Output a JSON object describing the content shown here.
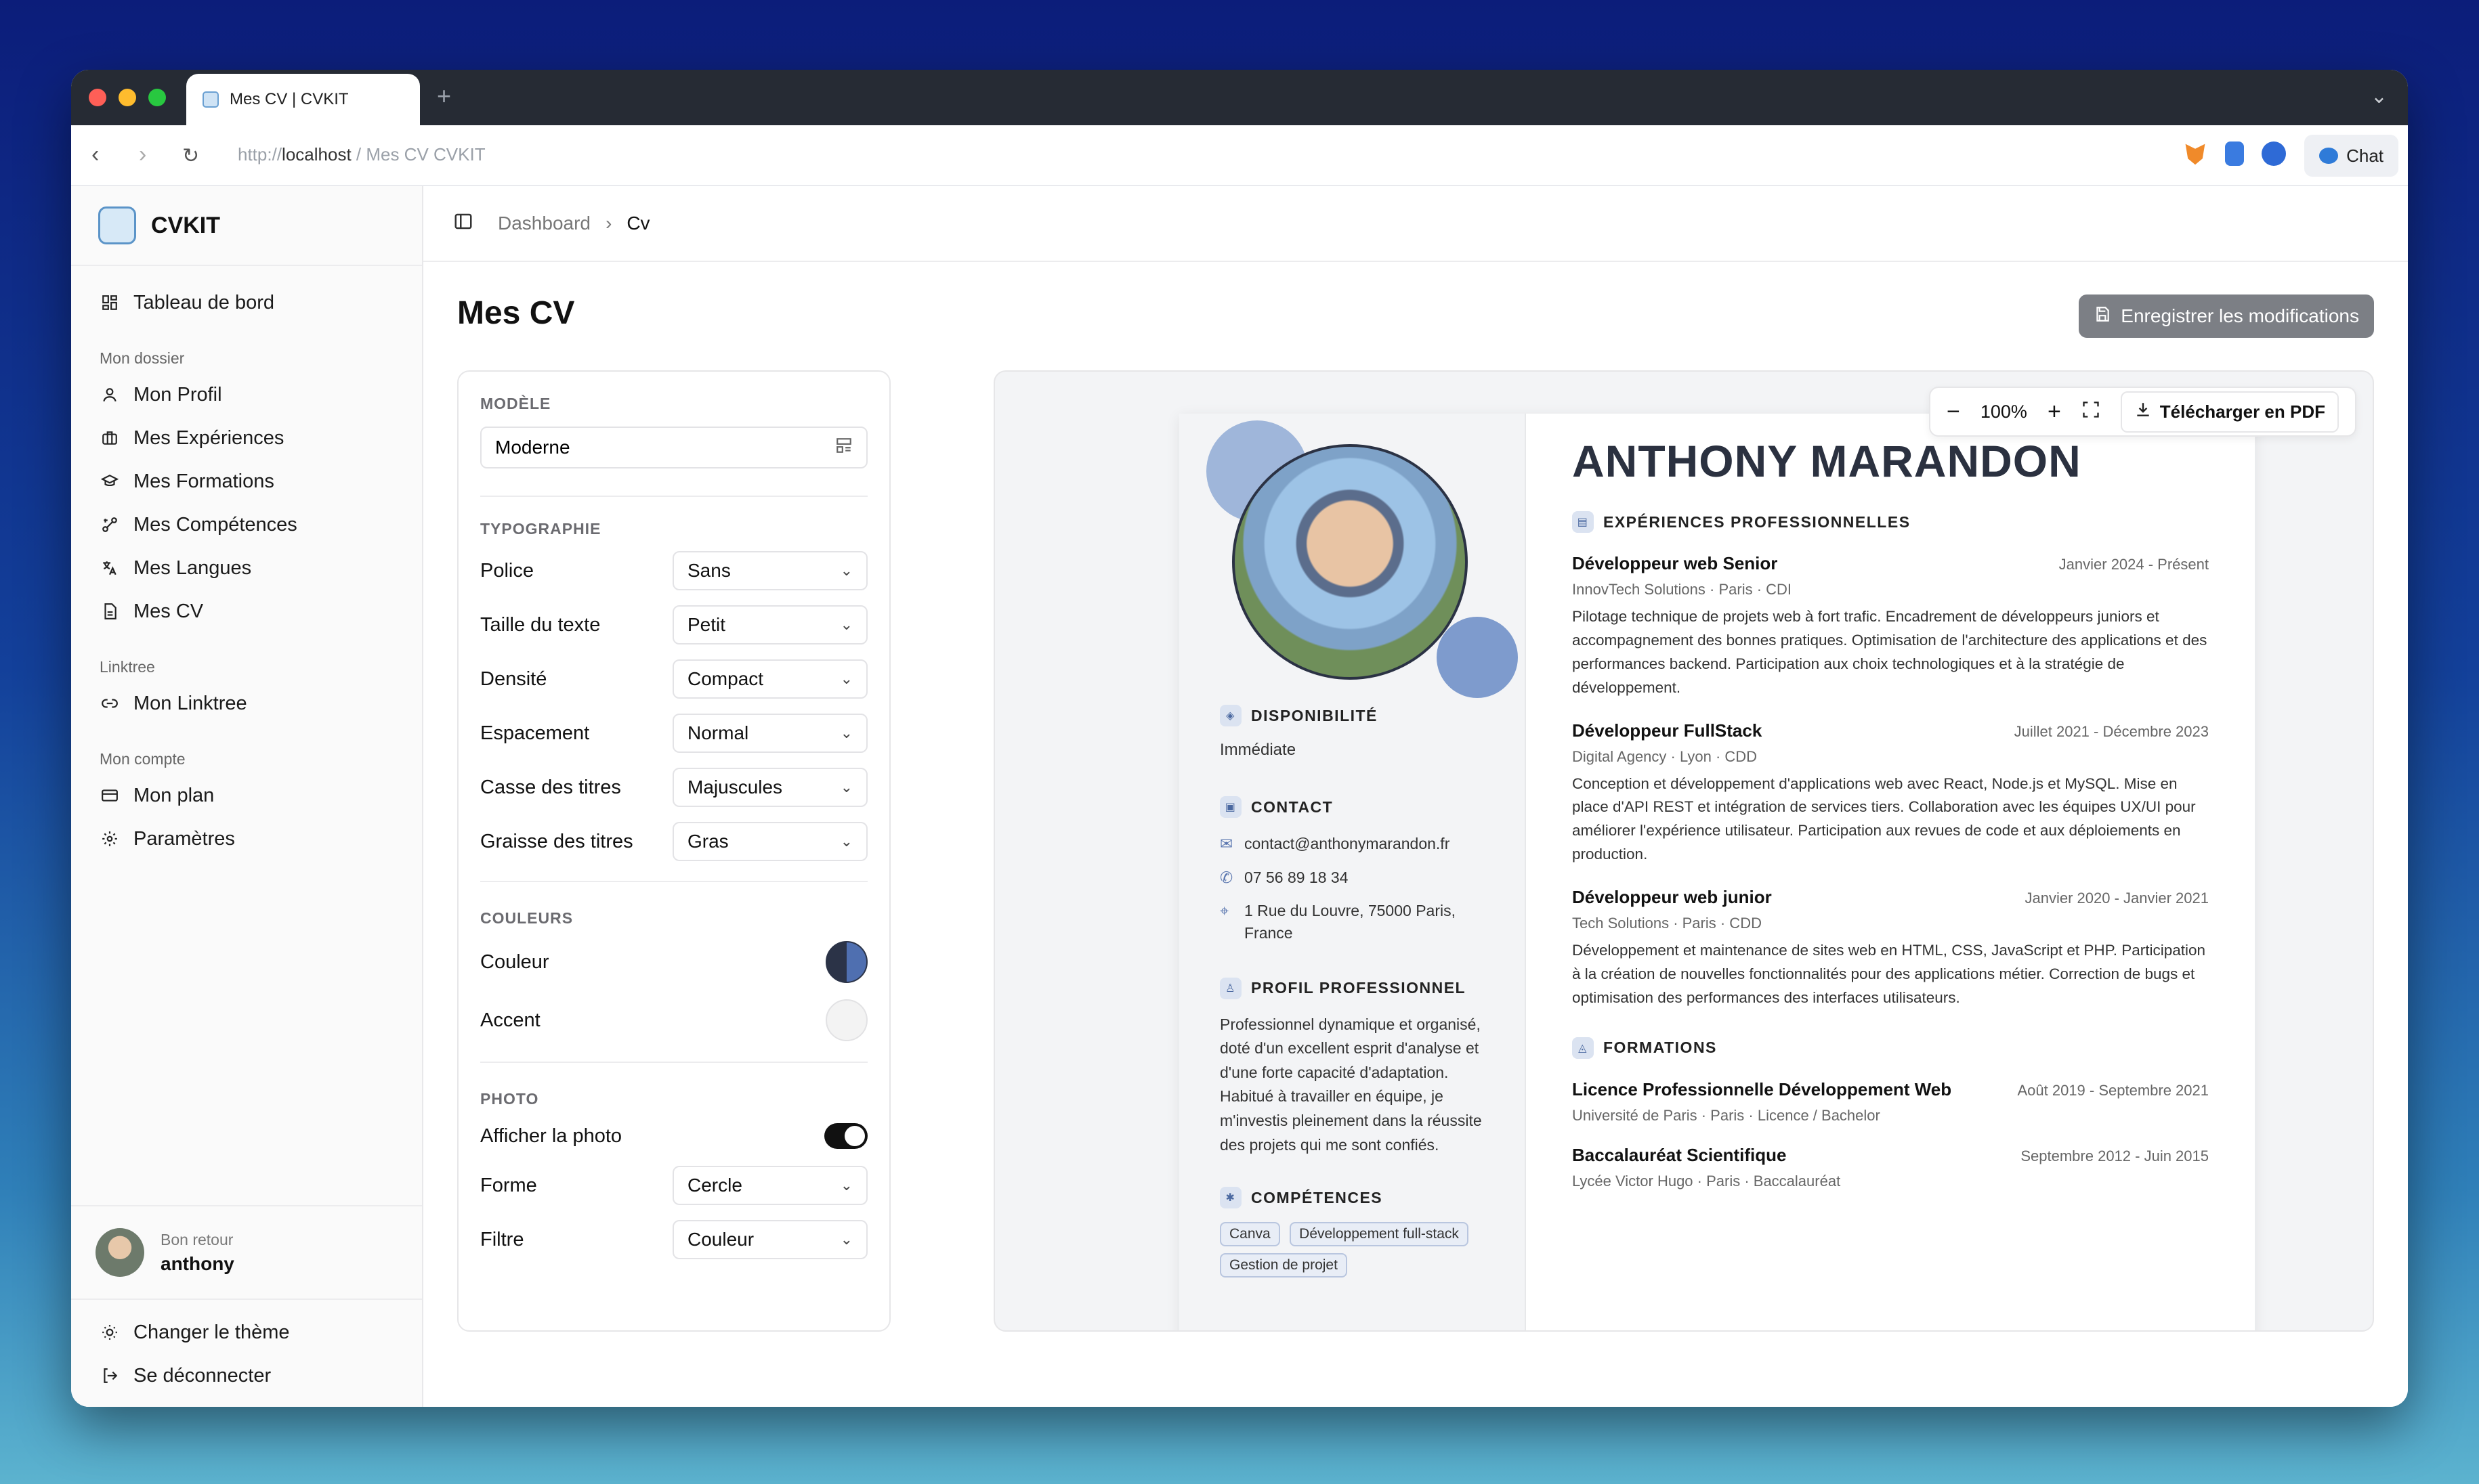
{
  "browser": {
    "tab_title": "Mes CV | CVKIT",
    "url_protocol": "http://",
    "url_host": "localhost",
    "url_path": " / Mes CV CVKIT",
    "chat_label": "Chat"
  },
  "sidebar": {
    "brand": "CVKIT",
    "top_item": "Tableau de bord",
    "section_dossier": "Mon dossier",
    "dossier_items": [
      "Mon Profil",
      "Mes Expériences",
      "Mes Formations",
      "Mes Compétences",
      "Mes Langues",
      "Mes CV"
    ],
    "section_linktree": "Linktree",
    "linktree_item": "Mon Linktree",
    "section_compte": "Mon compte",
    "compte_items": [
      "Mon plan",
      "Paramètres"
    ],
    "greeting": "Bon retour",
    "username": "anthony",
    "theme_label": "Changer le thème",
    "logout_label": "Se déconnecter"
  },
  "header": {
    "breadcrumb_root": "Dashboard",
    "breadcrumb_current": "Cv"
  },
  "page": {
    "title": "Mes CV",
    "save_label": "Enregistrer les modifications"
  },
  "settings": {
    "model_label": "MODÈLE",
    "model_value": "Moderne",
    "typo_label": "TYPOGRAPHIE",
    "police_label": "Police",
    "police_value": "Sans",
    "size_label": "Taille du texte",
    "size_value": "Petit",
    "density_label": "Densité",
    "density_value": "Compact",
    "spacing_label": "Espacement",
    "spacing_value": "Normal",
    "case_label": "Casse des titres",
    "case_value": "Majuscules",
    "weight_label": "Graisse des titres",
    "weight_value": "Gras",
    "colors_label": "COULEURS",
    "color_label": "Couleur",
    "accent_label": "Accent",
    "photo_label": "PHOTO",
    "show_photo_label": "Afficher la photo",
    "shape_label": "Forme",
    "shape_value": "Cercle",
    "filter_label": "Filtre",
    "filter_value": "Couleur"
  },
  "colors": {
    "primary": "#34456f",
    "accent": "#f3f3f3",
    "save_button": "#7c7f85"
  },
  "preview": {
    "zoom": "100%",
    "pdf_label": "Télécharger en PDF"
  },
  "cv": {
    "name": "ANTHONY MARANDON",
    "availability_title": "DISPONIBILITÉ",
    "availability_value": "Immédiate",
    "contact_title": "CONTACT",
    "email": "contact@anthonymarandon.fr",
    "phone": "07 56 89 18 34",
    "address": "1 Rue du Louvre, 75000 Paris, France",
    "profile_title": "PROFIL PROFESSIONNEL",
    "profile_text": "Professionnel dynamique et organisé, doté d'un excellent esprit d'analyse et d'une forte capacité d'adaptation. Habitué à travailler en équipe, je m'investis pleinement dans la réussite des projets qui me sont confiés.",
    "skills_title": "COMPÉTENCES",
    "skills": [
      "Canva",
      "Développement full-stack",
      "Gestion de projet"
    ],
    "experience_title": "EXPÉRIENCES PROFESSIONNELLES",
    "experiences": [
      {
        "title": "Développeur web Senior",
        "date": "Janvier 2024 - Présent",
        "sub": "InnovTech Solutions · Paris · CDI",
        "desc": "Pilotage technique de projets web à fort trafic. Encadrement de développeurs juniors et accompagnement des bonnes pratiques. Optimisation de l'architecture des applications et des performances backend. Participation aux choix technologiques et à la stratégie de développement."
      },
      {
        "title": "Développeur FullStack",
        "date": "Juillet 2021 - Décembre 2023",
        "sub": "Digital Agency · Lyon · CDD",
        "desc": "Conception et développement d'applications web avec React, Node.js et MySQL. Mise en place d'API REST et intégration de services tiers. Collaboration avec les équipes UX/UI pour améliorer l'expérience utilisateur. Participation aux revues de code et aux déploiements en production."
      },
      {
        "title": "Développeur web junior",
        "date": "Janvier 2020 - Janvier 2021",
        "sub": "Tech Solutions · Paris · CDD",
        "desc": "Développement et maintenance de sites web en HTML, CSS, JavaScript et PHP. Participation à la création de nouvelles fonctionnalités pour des applications métier. Correction de bugs et optimisation des performances des interfaces utilisateurs."
      }
    ],
    "education_title": "FORMATIONS",
    "education": [
      {
        "title": "Licence Professionnelle Développement Web",
        "date": "Août 2019 - Septembre 2021",
        "sub": "Université de Paris · Paris · Licence / Bachelor"
      },
      {
        "title": "Baccalauréat Scientifique",
        "date": "Septembre 2012 - Juin 2015",
        "sub": "Lycée Victor Hugo · Paris · Baccalauréat"
      }
    ]
  }
}
